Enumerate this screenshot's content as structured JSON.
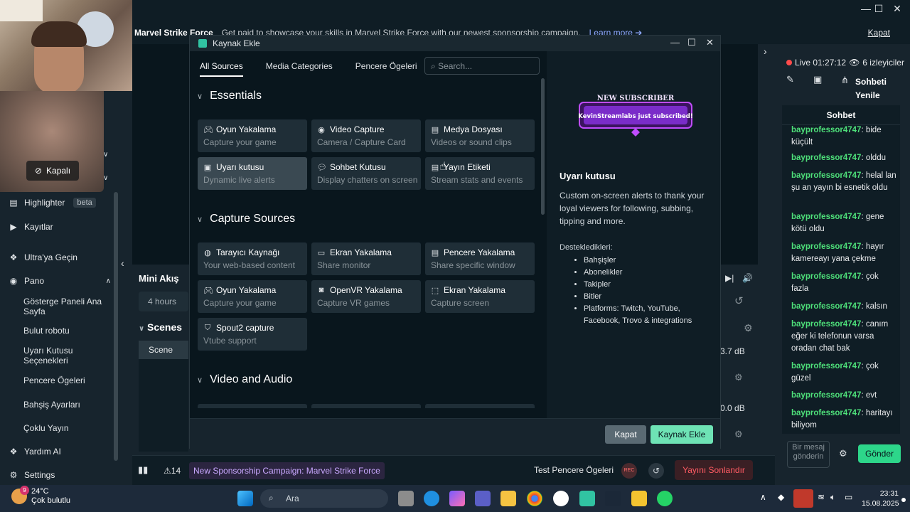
{
  "window": {
    "minimize": "—",
    "maximize": "☐",
    "close": "✕"
  },
  "banner": {
    "title": "Marvel Strike Force",
    "text": "Get paid to showcase your skills in Marvel Strike Force with our newest sponsorship campaign.",
    "link": "Learn more ➔",
    "close": "Kapat"
  },
  "webcam": {
    "off_label": "Kapalı"
  },
  "sidebar": {
    "highlighter": "Highlighter",
    "highlighter_badge": "beta",
    "kayitlar": "Kayıtlar",
    "ultra": "Ultra'ya Geçin",
    "pano": "Pano",
    "pano_items": [
      "Gösterge Paneli Ana Sayfa",
      "Bulut robotu",
      "Uyarı Kutusu Seçenekleri",
      "Pencere Ögeleri",
      "Bahşiş Ayarları",
      "Çoklu Yayın"
    ],
    "yardim": "Yardım AI",
    "settings": "Settings"
  },
  "main": {
    "mini_akis": "Mini Akış",
    "hours": "4 hours",
    "scenes": "Scenes",
    "scene": "Scene",
    "db1": "3.7 dB",
    "db2": "0.0 dB"
  },
  "statusbar": {
    "alert_count": "14",
    "campaign": "New Sponsorship Campaign: Marvel Strike Force",
    "test": "Test Pencere Ögeleri",
    "rec": "REC",
    "end": "Yayını Sonlandır"
  },
  "chat": {
    "live": "Live 01:27:12",
    "viewers": "6 izleyiciler",
    "refresh": "Sohbeti Yenile",
    "title": "Sohbet",
    "messages": [
      {
        "user": "bayprofessor4747",
        "text": "bide küçült"
      },
      {
        "user": "bayprofessor4747",
        "text": "olddu"
      },
      {
        "user": "bayprofessor4747",
        "text": "helal lan şu an yayın bi esnetik oldu"
      },
      {
        "user": "bayprofessor4747",
        "text": "gene kötü oldu"
      },
      {
        "user": "bayprofessor4747",
        "text": "hayır kamereayı yana çekme"
      },
      {
        "user": "bayprofessor4747",
        "text": "çok fazla"
      },
      {
        "user": "bayprofessor4747",
        "text": "kalsın"
      },
      {
        "user": "bayprofessor4747",
        "text": "canım eğer ki telefonun varsa oradan chat bak"
      },
      {
        "user": "bayprofessor4747",
        "text": "çok güzel"
      },
      {
        "user": "bayprofessor4747",
        "text": "evt"
      },
      {
        "user": "bayprofessor4747",
        "text": "haritayı biliyom"
      }
    ],
    "input_placeholder": "Bir mesaj gönderin",
    "send": "Gönder"
  },
  "modal": {
    "title": "Kaynak Ekle",
    "tabs": [
      "All Sources",
      "Media Categories",
      "Pencere Ögeleri"
    ],
    "search_placeholder": "Search...",
    "sections": {
      "essentials": "Essentials",
      "capture": "Capture Sources",
      "video": "Video and Audio"
    },
    "cards": {
      "oyun1": {
        "title": "Oyun Yakalama",
        "sub": "Capture your game"
      },
      "video": {
        "title": "Video Capture",
        "sub": "Camera / Capture Card"
      },
      "medya": {
        "title": "Medya Dosyası",
        "sub": "Videos or sound clips"
      },
      "uyari": {
        "title": "Uyarı kutusu",
        "sub": "Dynamic live alerts"
      },
      "sohbet": {
        "title": "Sohbet Kutusu",
        "sub": "Display chatters on screen"
      },
      "etiket": {
        "title": "Yayın Etiketi",
        "sub": "Stream stats and events"
      },
      "tarayici": {
        "title": "Tarayıcı Kaynağı",
        "sub": "Your web-based content"
      },
      "ekran1": {
        "title": "Ekran Yakalama",
        "sub": "Share monitor"
      },
      "pencere": {
        "title": "Pencere Yakalama",
        "sub": "Share specific window"
      },
      "oyun2": {
        "title": "Oyun Yakalama",
        "sub": "Capture your game"
      },
      "openvr": {
        "title": "OpenVR Yakalama",
        "sub": "Capture VR games"
      },
      "ekran2": {
        "title": "Ekran Yakalama",
        "sub": "Capture screen"
      },
      "spout": {
        "title": "Spout2 capture",
        "sub": "Vtube support"
      }
    },
    "preview": {
      "line1": "NEW SUBSCRIBER",
      "line2": "KevinStreamlabs just subscribed!"
    },
    "info_title": "Uyarı kutusu",
    "info_desc": "Custom on-screen alerts to thank your loyal viewers for following, subbing, tipping and more.",
    "supported_title": "Destekledikleri:",
    "supported": [
      "Bahşişler",
      "Abonelikler",
      "Takipler",
      "Bitler",
      "Platforms: Twitch, YouTube, Facebook, Trovo & integrations"
    ],
    "cancel": "Kapat",
    "add": "Kaynak Ekle"
  },
  "taskbar": {
    "temp": "24°C",
    "weather": "Çok bulutlu",
    "weather_badge": "9",
    "search": "Ara",
    "time": "23:31",
    "date": "15.08.2025"
  },
  "colors": {
    "accent": "#31c3a2",
    "chat_user": "#4ee07a",
    "end_stream": "#ff5b63",
    "campaign": "#c9a8ff"
  }
}
